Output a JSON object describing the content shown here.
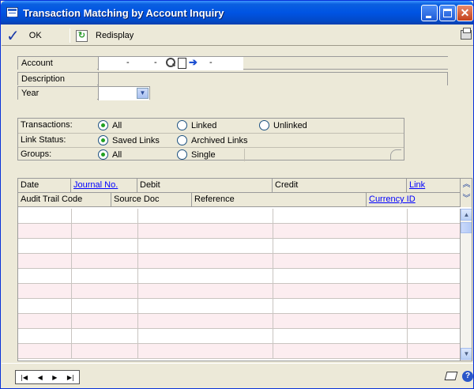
{
  "window": {
    "title": "Transaction Matching by Account Inquiry",
    "minimize_icon": "minimize-icon",
    "maximize_icon": "maximize-icon",
    "close_icon": "close-icon"
  },
  "toolbar": {
    "ok_label": "OK",
    "redisplay_label": "Redisplay",
    "ok_icon": "checkmark-icon",
    "redisplay_icon": "refresh-icon",
    "print_icon": "printer-icon"
  },
  "header": {
    "account_label": "Account",
    "account_segments": [
      "-",
      "-",
      "-",
      "-"
    ],
    "description_label": "Description",
    "description_value": "",
    "year_label": "Year",
    "year_value": ""
  },
  "options": {
    "transactions_label": "Transactions:",
    "transactions": [
      {
        "label": "All",
        "selected": true
      },
      {
        "label": "Linked",
        "selected": false
      },
      {
        "label": "Unlinked",
        "selected": false
      }
    ],
    "link_status_label": "Link Status:",
    "link_status": [
      {
        "label": "Saved Links",
        "selected": true
      },
      {
        "label": "Archived Links",
        "selected": false
      }
    ],
    "groups_label": "Groups:",
    "groups": [
      {
        "label": "All",
        "selected": true
      },
      {
        "label": "Single",
        "selected": false
      }
    ]
  },
  "grid": {
    "header_row1": [
      "Date",
      "Journal No.",
      "Debit",
      "Credit",
      "Link"
    ],
    "header_row2": [
      "Audit Trail Code",
      "Source Doc",
      "Reference",
      "Currency ID"
    ],
    "row_count": 10
  },
  "colors": {
    "alt_row": "#FCEDF0",
    "link": "#0000FF",
    "frame": "#ECE9D8"
  }
}
